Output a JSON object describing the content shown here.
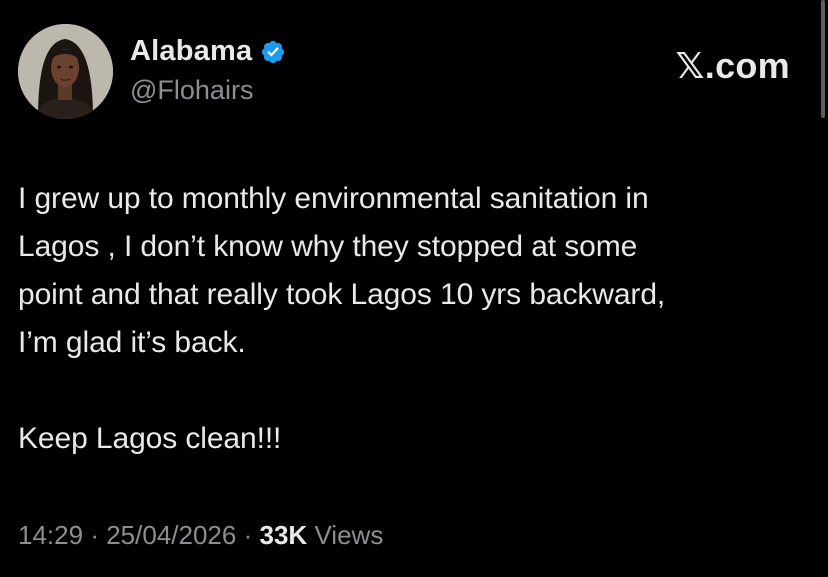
{
  "author": {
    "display_name": "Alabama",
    "handle": "@Flohairs",
    "verified": true,
    "avatar_icon": "profile-photo"
  },
  "brand": {
    "label": "𝕏.com"
  },
  "tweet": {
    "lines": [
      "I grew up to monthly environmental sanitation in",
      "Lagos , I don’t know why they stopped at some",
      "point and that really took Lagos 10 yrs backward,",
      "I’m glad it’s back.",
      "Keep Lagos clean!!!"
    ]
  },
  "meta": {
    "time": "14:29",
    "separator": "·",
    "date": "25/04/2026",
    "views_count": "33K",
    "views_label": "Views"
  },
  "colors": {
    "background": "#000000",
    "primary_text": "#e7e9ea",
    "secondary_text": "#8b8f94",
    "verified_badge": "#1d9bf0"
  }
}
